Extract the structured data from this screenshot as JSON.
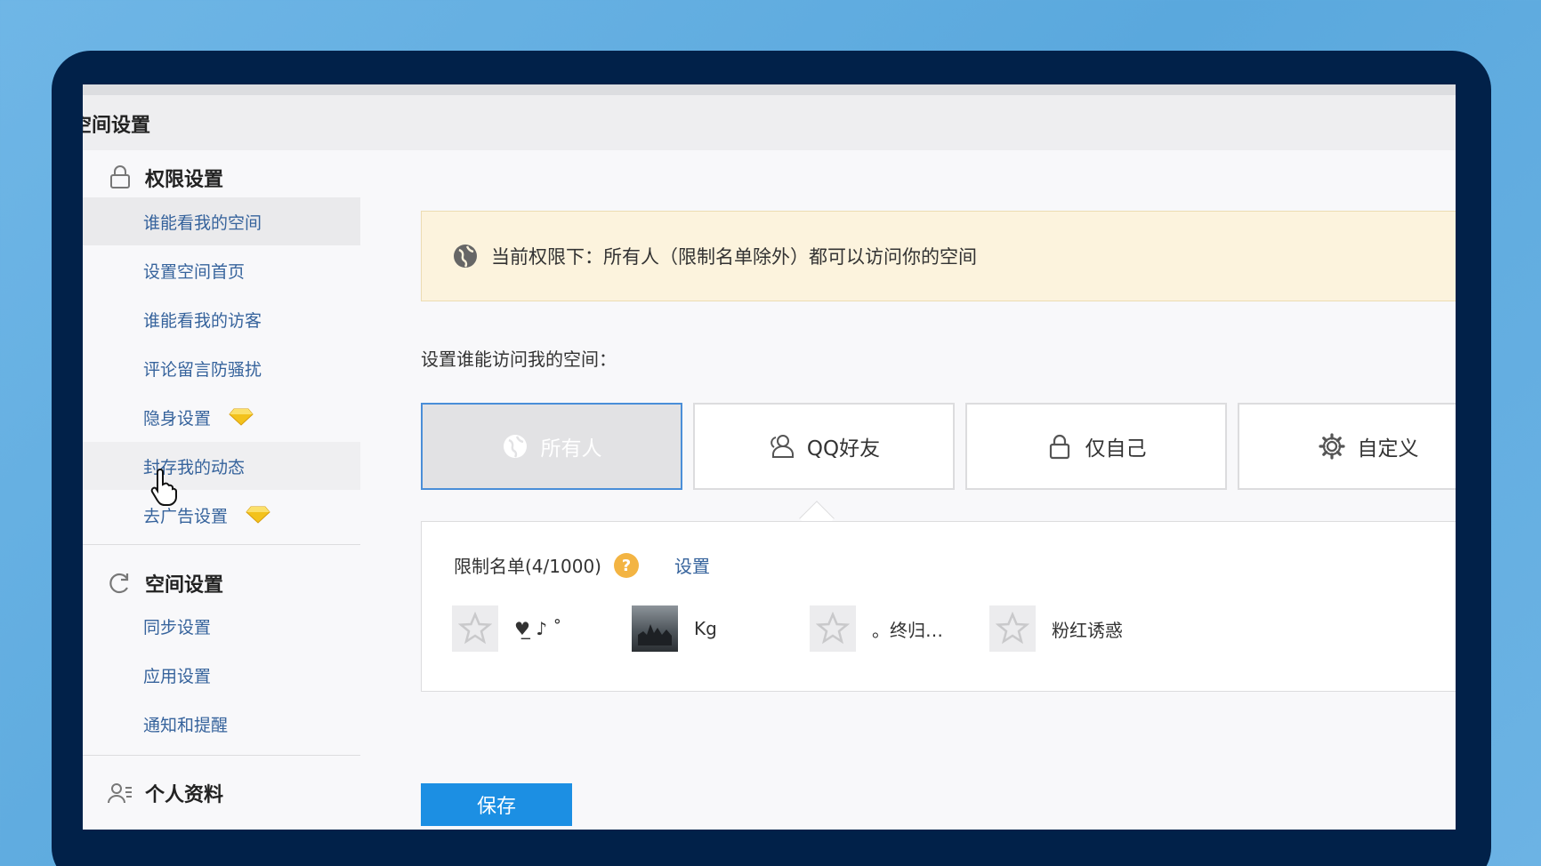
{
  "window": {
    "title": "空间设置"
  },
  "sidebar": {
    "sections": [
      {
        "label": "权限设置",
        "icon": "lock-icon"
      },
      {
        "label": "空间设置",
        "icon": "refresh-icon"
      },
      {
        "label": "个人资料",
        "icon": "user-profile-icon"
      }
    ],
    "permission_items": [
      "谁能看我的空间",
      "设置空间首页",
      "谁能看我的访客",
      "评论留言防骚扰",
      "隐身设置",
      "封存我的动态",
      "去广告设置"
    ],
    "space_items": [
      "同步设置",
      "应用设置",
      "通知和提醒"
    ]
  },
  "notice": {
    "text": "当前权限下：所有人（限制名单除外）都可以访问你的空间"
  },
  "prompt": "设置谁能访问我的空间：",
  "options": [
    {
      "label": "所有人",
      "icon": "globe-icon",
      "selected": true
    },
    {
      "label": "QQ好友",
      "icon": "friends-icon",
      "selected": false
    },
    {
      "label": "仅自己",
      "icon": "lock-icon",
      "selected": false
    },
    {
      "label": "自定义",
      "icon": "gear-icon",
      "selected": false
    }
  ],
  "restrict": {
    "title": "限制名单(4/1000)",
    "help": "?",
    "set_label": "设置",
    "members": [
      {
        "name": "♥̲ ♪ ˚",
        "avatar": "star-avatar-icon"
      },
      {
        "name": "Kg",
        "avatar": "photo"
      },
      {
        "name": "。终归…",
        "avatar": "star-avatar-icon"
      },
      {
        "name": "粉红诱惑",
        "avatar": "star-avatar-icon"
      }
    ]
  },
  "save_label": "保存",
  "colors": {
    "accent": "#1c8fe3",
    "link": "#36639c",
    "notice_bg": "#fcf3dd",
    "bezel": "#012149",
    "diamond": "#f3c21c"
  }
}
